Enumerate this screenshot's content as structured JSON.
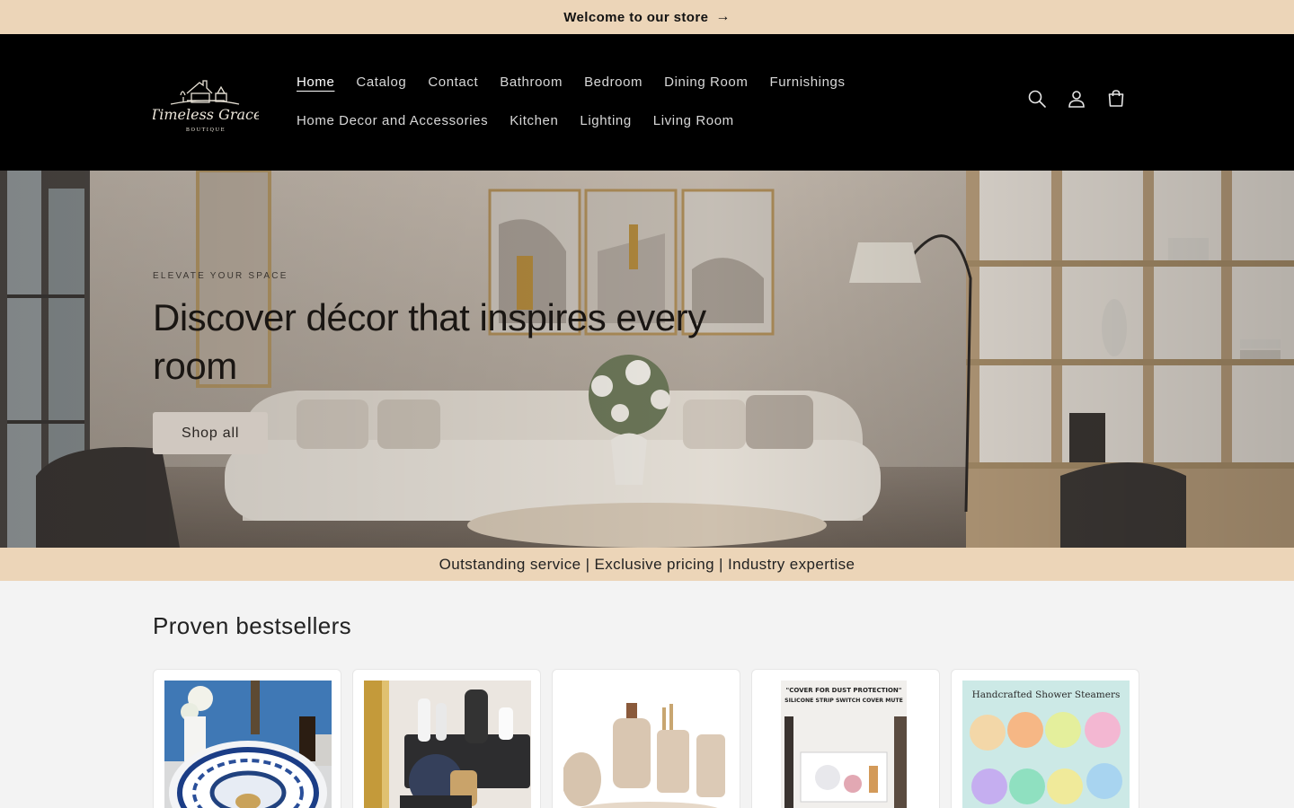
{
  "announcement": {
    "text": "Welcome to our store",
    "arrow": "→"
  },
  "header": {
    "logo": {
      "brand": "Timeless Grace",
      "sub": "BOUTIQUE"
    },
    "nav_row1": [
      "Home",
      "Catalog",
      "Contact",
      "Bathroom",
      "Bedroom",
      "Dining Room",
      "Furnishings"
    ],
    "nav_row2": [
      "Home Decor and Accessories",
      "Kitchen",
      "Lighting",
      "Living Room"
    ],
    "active_nav": "Home",
    "icons": [
      "search-icon",
      "account-icon",
      "cart-icon"
    ]
  },
  "hero": {
    "kicker": "ELEVATE YOUR SPACE",
    "title": "Discover décor that inspires every room",
    "button": "Shop all"
  },
  "values_bar": {
    "text": "Outstanding service | Exclusive pricing | Industry expertise"
  },
  "bestsellers": {
    "title": "Proven bestsellers",
    "products": [
      {
        "image": "blue-white-porcelain-sink"
      },
      {
        "image": "hair-dryer-holder"
      },
      {
        "image": "ceramic-bath-set"
      },
      {
        "image": "switch-cover",
        "caption_line1": "\"COVER FOR DUST PROTECTION\"",
        "caption_line2": "SILICONE STRIP SWITCH COVER MUTE"
      },
      {
        "image": "shower-steamers",
        "caption": "Handcrafted Shower Steamers"
      }
    ]
  },
  "colors": {
    "accent_beige": "#ecd5b8",
    "header_bg": "#000000",
    "page_bg": "#f3f3f3"
  }
}
